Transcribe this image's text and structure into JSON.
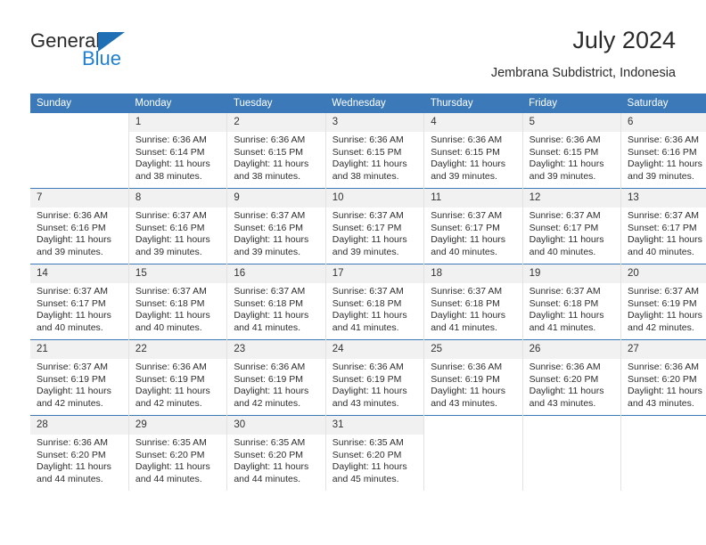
{
  "brand": {
    "name_top": "General",
    "name_bottom": "Blue",
    "accent_color": "#1f7fd0",
    "triangle_color": "#1f6fb5"
  },
  "header": {
    "title": "July 2024",
    "subtitle": "Jembrana Subdistrict, Indonesia"
  },
  "calendar": {
    "header_bg": "#3b79b8",
    "header_text_color": "#ffffff",
    "daynum_bg": "#f1f1f1",
    "weekdays": [
      "Sunday",
      "Monday",
      "Tuesday",
      "Wednesday",
      "Thursday",
      "Friday",
      "Saturday"
    ],
    "weeks": [
      [
        {
          "day": "",
          "sunrise": "",
          "sunset": "",
          "daylight_line1": "",
          "daylight_line2": ""
        },
        {
          "day": "1",
          "sunrise": "Sunrise: 6:36 AM",
          "sunset": "Sunset: 6:14 PM",
          "daylight_line1": "Daylight: 11 hours",
          "daylight_line2": "and 38 minutes."
        },
        {
          "day": "2",
          "sunrise": "Sunrise: 6:36 AM",
          "sunset": "Sunset: 6:15 PM",
          "daylight_line1": "Daylight: 11 hours",
          "daylight_line2": "and 38 minutes."
        },
        {
          "day": "3",
          "sunrise": "Sunrise: 6:36 AM",
          "sunset": "Sunset: 6:15 PM",
          "daylight_line1": "Daylight: 11 hours",
          "daylight_line2": "and 38 minutes."
        },
        {
          "day": "4",
          "sunrise": "Sunrise: 6:36 AM",
          "sunset": "Sunset: 6:15 PM",
          "daylight_line1": "Daylight: 11 hours",
          "daylight_line2": "and 39 minutes."
        },
        {
          "day": "5",
          "sunrise": "Sunrise: 6:36 AM",
          "sunset": "Sunset: 6:15 PM",
          "daylight_line1": "Daylight: 11 hours",
          "daylight_line2": "and 39 minutes."
        },
        {
          "day": "6",
          "sunrise": "Sunrise: 6:36 AM",
          "sunset": "Sunset: 6:16 PM",
          "daylight_line1": "Daylight: 11 hours",
          "daylight_line2": "and 39 minutes."
        }
      ],
      [
        {
          "day": "7",
          "sunrise": "Sunrise: 6:36 AM",
          "sunset": "Sunset: 6:16 PM",
          "daylight_line1": "Daylight: 11 hours",
          "daylight_line2": "and 39 minutes."
        },
        {
          "day": "8",
          "sunrise": "Sunrise: 6:37 AM",
          "sunset": "Sunset: 6:16 PM",
          "daylight_line1": "Daylight: 11 hours",
          "daylight_line2": "and 39 minutes."
        },
        {
          "day": "9",
          "sunrise": "Sunrise: 6:37 AM",
          "sunset": "Sunset: 6:16 PM",
          "daylight_line1": "Daylight: 11 hours",
          "daylight_line2": "and 39 minutes."
        },
        {
          "day": "10",
          "sunrise": "Sunrise: 6:37 AM",
          "sunset": "Sunset: 6:17 PM",
          "daylight_line1": "Daylight: 11 hours",
          "daylight_line2": "and 39 minutes."
        },
        {
          "day": "11",
          "sunrise": "Sunrise: 6:37 AM",
          "sunset": "Sunset: 6:17 PM",
          "daylight_line1": "Daylight: 11 hours",
          "daylight_line2": "and 40 minutes."
        },
        {
          "day": "12",
          "sunrise": "Sunrise: 6:37 AM",
          "sunset": "Sunset: 6:17 PM",
          "daylight_line1": "Daylight: 11 hours",
          "daylight_line2": "and 40 minutes."
        },
        {
          "day": "13",
          "sunrise": "Sunrise: 6:37 AM",
          "sunset": "Sunset: 6:17 PM",
          "daylight_line1": "Daylight: 11 hours",
          "daylight_line2": "and 40 minutes."
        }
      ],
      [
        {
          "day": "14",
          "sunrise": "Sunrise: 6:37 AM",
          "sunset": "Sunset: 6:17 PM",
          "daylight_line1": "Daylight: 11 hours",
          "daylight_line2": "and 40 minutes."
        },
        {
          "day": "15",
          "sunrise": "Sunrise: 6:37 AM",
          "sunset": "Sunset: 6:18 PM",
          "daylight_line1": "Daylight: 11 hours",
          "daylight_line2": "and 40 minutes."
        },
        {
          "day": "16",
          "sunrise": "Sunrise: 6:37 AM",
          "sunset": "Sunset: 6:18 PM",
          "daylight_line1": "Daylight: 11 hours",
          "daylight_line2": "and 41 minutes."
        },
        {
          "day": "17",
          "sunrise": "Sunrise: 6:37 AM",
          "sunset": "Sunset: 6:18 PM",
          "daylight_line1": "Daylight: 11 hours",
          "daylight_line2": "and 41 minutes."
        },
        {
          "day": "18",
          "sunrise": "Sunrise: 6:37 AM",
          "sunset": "Sunset: 6:18 PM",
          "daylight_line1": "Daylight: 11 hours",
          "daylight_line2": "and 41 minutes."
        },
        {
          "day": "19",
          "sunrise": "Sunrise: 6:37 AM",
          "sunset": "Sunset: 6:18 PM",
          "daylight_line1": "Daylight: 11 hours",
          "daylight_line2": "and 41 minutes."
        },
        {
          "day": "20",
          "sunrise": "Sunrise: 6:37 AM",
          "sunset": "Sunset: 6:19 PM",
          "daylight_line1": "Daylight: 11 hours",
          "daylight_line2": "and 42 minutes."
        }
      ],
      [
        {
          "day": "21",
          "sunrise": "Sunrise: 6:37 AM",
          "sunset": "Sunset: 6:19 PM",
          "daylight_line1": "Daylight: 11 hours",
          "daylight_line2": "and 42 minutes."
        },
        {
          "day": "22",
          "sunrise": "Sunrise: 6:36 AM",
          "sunset": "Sunset: 6:19 PM",
          "daylight_line1": "Daylight: 11 hours",
          "daylight_line2": "and 42 minutes."
        },
        {
          "day": "23",
          "sunrise": "Sunrise: 6:36 AM",
          "sunset": "Sunset: 6:19 PM",
          "daylight_line1": "Daylight: 11 hours",
          "daylight_line2": "and 42 minutes."
        },
        {
          "day": "24",
          "sunrise": "Sunrise: 6:36 AM",
          "sunset": "Sunset: 6:19 PM",
          "daylight_line1": "Daylight: 11 hours",
          "daylight_line2": "and 43 minutes."
        },
        {
          "day": "25",
          "sunrise": "Sunrise: 6:36 AM",
          "sunset": "Sunset: 6:19 PM",
          "daylight_line1": "Daylight: 11 hours",
          "daylight_line2": "and 43 minutes."
        },
        {
          "day": "26",
          "sunrise": "Sunrise: 6:36 AM",
          "sunset": "Sunset: 6:20 PM",
          "daylight_line1": "Daylight: 11 hours",
          "daylight_line2": "and 43 minutes."
        },
        {
          "day": "27",
          "sunrise": "Sunrise: 6:36 AM",
          "sunset": "Sunset: 6:20 PM",
          "daylight_line1": "Daylight: 11 hours",
          "daylight_line2": "and 43 minutes."
        }
      ],
      [
        {
          "day": "28",
          "sunrise": "Sunrise: 6:36 AM",
          "sunset": "Sunset: 6:20 PM",
          "daylight_line1": "Daylight: 11 hours",
          "daylight_line2": "and 44 minutes."
        },
        {
          "day": "29",
          "sunrise": "Sunrise: 6:35 AM",
          "sunset": "Sunset: 6:20 PM",
          "daylight_line1": "Daylight: 11 hours",
          "daylight_line2": "and 44 minutes."
        },
        {
          "day": "30",
          "sunrise": "Sunrise: 6:35 AM",
          "sunset": "Sunset: 6:20 PM",
          "daylight_line1": "Daylight: 11 hours",
          "daylight_line2": "and 44 minutes."
        },
        {
          "day": "31",
          "sunrise": "Sunrise: 6:35 AM",
          "sunset": "Sunset: 6:20 PM",
          "daylight_line1": "Daylight: 11 hours",
          "daylight_line2": "and 45 minutes."
        },
        {
          "day": "",
          "sunrise": "",
          "sunset": "",
          "daylight_line1": "",
          "daylight_line2": ""
        },
        {
          "day": "",
          "sunrise": "",
          "sunset": "",
          "daylight_line1": "",
          "daylight_line2": ""
        },
        {
          "day": "",
          "sunrise": "",
          "sunset": "",
          "daylight_line1": "",
          "daylight_line2": ""
        }
      ]
    ]
  }
}
